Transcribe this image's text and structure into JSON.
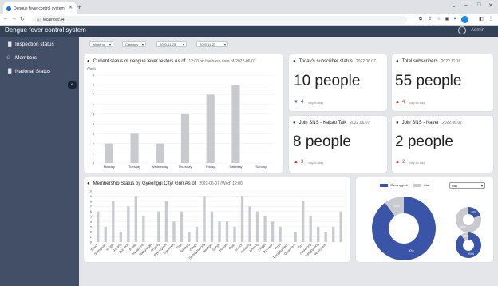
{
  "browser": {
    "tab_title": "Dengue fever control system",
    "url": "localhost:34",
    "window_controls": [
      "⌄",
      "–",
      "□",
      "✕"
    ]
  },
  "app": {
    "title": "Dengue fever control system",
    "user": "Admin"
  },
  "sidebar": {
    "items": [
      {
        "icon": "bar-chart-icon",
        "label": "Inspection status"
      },
      {
        "icon": "person-icon",
        "label": "Members"
      },
      {
        "icon": "bar-chart-icon",
        "label": "National Status"
      }
    ],
    "collapse_glyph": "«"
  },
  "filters": [
    {
      "value": "whole na"
    },
    {
      "value": "Category"
    },
    {
      "value": "2020-11-25"
    },
    {
      "value": "2020-11-25"
    }
  ],
  "tester_card": {
    "title": "Current status of dengue fever testers As of",
    "date_prefix": "12:00 on the base date of",
    "date": "2022-06-07",
    "unit_label": "(Wed)",
    "chart_data": {
      "type": "bar",
      "categories": [
        "Monday",
        "Tuesday",
        "Wednesday",
        "Thursday",
        "Friday",
        "Saturday",
        "Sunday"
      ],
      "values": [
        2,
        3,
        2,
        5,
        7,
        8,
        0
      ],
      "ylim": [
        0,
        9
      ],
      "yticks": [
        0,
        1,
        2,
        3,
        4,
        5,
        6,
        7,
        8,
        9
      ],
      "bar_color": "#c8cacf"
    }
  },
  "stats": [
    {
      "title": "Today's subscriber status",
      "date": "2022.06.07",
      "value": "10 people",
      "change_dir": "down",
      "change": "4",
      "change_label": "day-to-day"
    },
    {
      "title": "Total subscribers",
      "date": "2022.11.16",
      "value": "55 people",
      "change_dir": "up",
      "change": "4",
      "change_label": "day-to-day"
    },
    {
      "title": "Join SNS - Kakao Talk",
      "date": "2022.06.07",
      "value": "8 people",
      "change_dir": "up",
      "change": "3",
      "change_label": "day-to-day"
    },
    {
      "title": "Join SNS - Naver",
      "date": "2022.06.07",
      "value": "2 people",
      "change_dir": "up",
      "change": "2",
      "change_label": "day-to-day"
    }
  ],
  "membership_card": {
    "title": "Membership Status by Gyeonggi City/ Gun As of",
    "date": "2022-06-07 (Wed) 12:00",
    "chart_data": {
      "type": "bar",
      "categories": [
        "Suwon",
        "Seongnam",
        "Yongin",
        "Goyang",
        "Bucheon",
        "Ansan",
        "Hwaseong",
        "Namyangju",
        "Anyang",
        "Pyeongtaek",
        "Uijeongbu",
        "Paju",
        "Siheung",
        "Gimpo",
        "Gwangmyeong",
        "Gwangju",
        "Gunpo",
        "Hanam",
        "Osan",
        "Icheon",
        "Anseong",
        "Uiwang",
        "Yangju",
        "Pocheon",
        "Yeoju",
        "Dongducheon",
        "Gwacheon",
        "Guri",
        "Gapyeong",
        "Yangpyeong",
        "Yeoncheon"
      ],
      "values": [
        6,
        3,
        8,
        2,
        7,
        9,
        5,
        0,
        6,
        8,
        4,
        6,
        2,
        3,
        9,
        6,
        4,
        4,
        3,
        9,
        7,
        6,
        5,
        4,
        3,
        0,
        2,
        8,
        5,
        3,
        2,
        3,
        6
      ],
      "ylim": [
        0,
        10
      ],
      "yticks": [
        0,
        1,
        2,
        3,
        4,
        5,
        6,
        7,
        8,
        9,
        10
      ],
      "bar_color": "#c8cacf"
    }
  },
  "donut_card": {
    "legend": [
      {
        "label": "Gyeonggi-di",
        "color": "#3a55a8"
      },
      {
        "label": "total",
        "color": "#c8cacf"
      }
    ],
    "period_select": "Day",
    "chart_data": [
      {
        "type": "pie",
        "name": "main",
        "slices": [
          {
            "label": "Gyeonggi-di",
            "value": 90
          },
          {
            "label": "total",
            "value": 10
          }
        ],
        "labels": [
          "90%",
          "10%"
        ]
      },
      {
        "type": "pie",
        "name": "small-top",
        "slices": [
          {
            "label": "Gyeonggi-di",
            "value": 20
          },
          {
            "label": "total",
            "value": 80
          }
        ],
        "labels": [
          "20%",
          "80%"
        ]
      },
      {
        "type": "pie",
        "name": "small-bottom",
        "slices": [
          {
            "label": "Gyeonggi-di",
            "value": 90
          },
          {
            "label": "total",
            "value": 10
          }
        ],
        "labels": [
          "90%",
          "10%"
        ]
      }
    ]
  },
  "colors": {
    "header": "#334157",
    "sidebar": "#434f66",
    "accent_blue": "#3a55a8",
    "down": "#2f52a0",
    "up": "#d23a2e"
  }
}
